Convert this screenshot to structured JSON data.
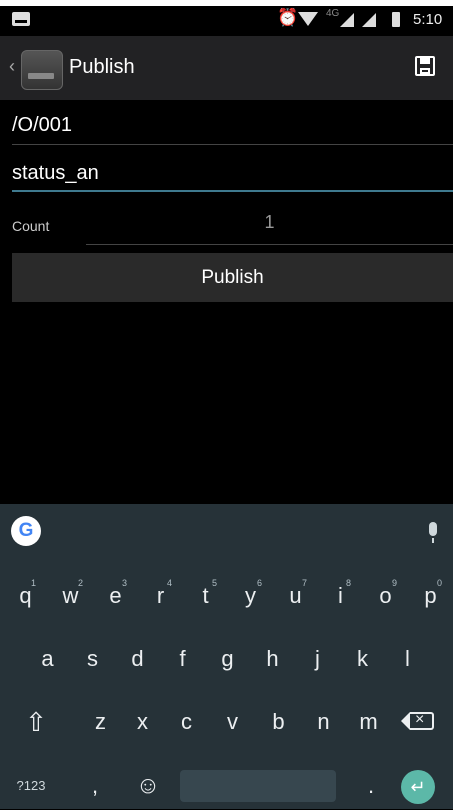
{
  "status_bar": {
    "time": "5:10",
    "network_label": "4G",
    "alarm_glyph": "⏰"
  },
  "action_bar": {
    "title": "Publish",
    "back_glyph": "‹"
  },
  "form": {
    "topic_value": "/O/001",
    "payload_value": "status_an",
    "count_label": "Count",
    "count_value": "1",
    "publish_button_label": "Publish"
  },
  "keyboard": {
    "google_logo": "G",
    "row1": [
      {
        "key": "q",
        "hint": "1"
      },
      {
        "key": "w",
        "hint": "2"
      },
      {
        "key": "e",
        "hint": "3"
      },
      {
        "key": "r",
        "hint": "4"
      },
      {
        "key": "t",
        "hint": "5"
      },
      {
        "key": "y",
        "hint": "6"
      },
      {
        "key": "u",
        "hint": "7"
      },
      {
        "key": "i",
        "hint": "8"
      },
      {
        "key": "o",
        "hint": "9"
      },
      {
        "key": "p",
        "hint": "0"
      }
    ],
    "row2": [
      "a",
      "s",
      "d",
      "f",
      "g",
      "h",
      "j",
      "k",
      "l"
    ],
    "row3": [
      "z",
      "x",
      "c",
      "v",
      "b",
      "n",
      "m"
    ],
    "shift_glyph": "⇧",
    "symbols_label": "?123",
    "comma_label": ",",
    "emoji_glyph": "☺",
    "period_label": ".",
    "enter_glyph": "↵"
  }
}
